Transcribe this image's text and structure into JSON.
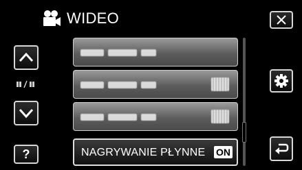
{
  "header": {
    "title": "WIDEO",
    "icon": "video-camera-icon"
  },
  "side_left": {
    "up_icon": "chevron-up-icon",
    "page_indicator_icon": "page-indicator-icon",
    "down_icon": "chevron-down-icon",
    "help_label": "?"
  },
  "side_right": {
    "close_icon": "close-icon",
    "settings_icon": "gear-icon",
    "back_icon": "return-icon"
  },
  "menu": {
    "items": [
      {
        "label": "",
        "value": ""
      },
      {
        "label": "",
        "value": ""
      },
      {
        "label": "",
        "value": ""
      },
      {
        "label": "NAGRYWANIE PŁYNNE",
        "value": "ON"
      }
    ]
  },
  "scrollbar": {
    "position": 0.75
  },
  "colors": {
    "background": "#000000",
    "button_border": "#d8d8d8",
    "menu_item_gray": "#7a7a7a",
    "text": "#ffffff"
  }
}
